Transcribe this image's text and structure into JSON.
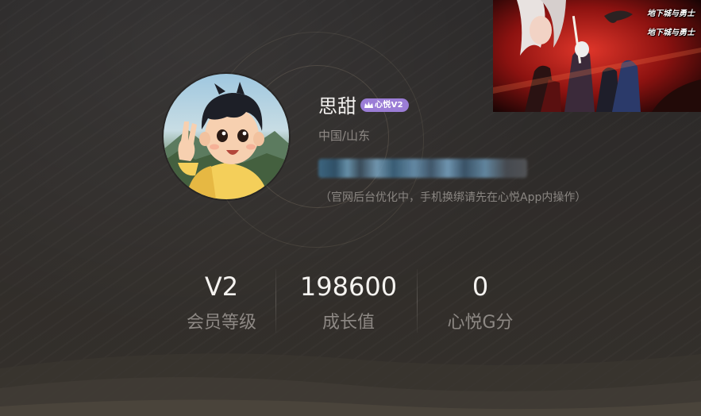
{
  "profile": {
    "username": "思甜",
    "vip_badge": "心悦V2",
    "location": "中国/山东",
    "notice": "（官网后台优化中，手机换绑请先在心悦App内操作）"
  },
  "stats": [
    {
      "value": "V2",
      "label": "会员等级"
    },
    {
      "value": "198600",
      "label": "成长值"
    },
    {
      "value": "0",
      "label": "心悦G分"
    }
  ],
  "banner": {
    "logo_text": "地下城与勇士"
  },
  "colors": {
    "background": "#2e2b29",
    "badge": "#9b7dd6",
    "text_primary": "#f2f0ee",
    "text_secondary": "#8f8a86"
  }
}
